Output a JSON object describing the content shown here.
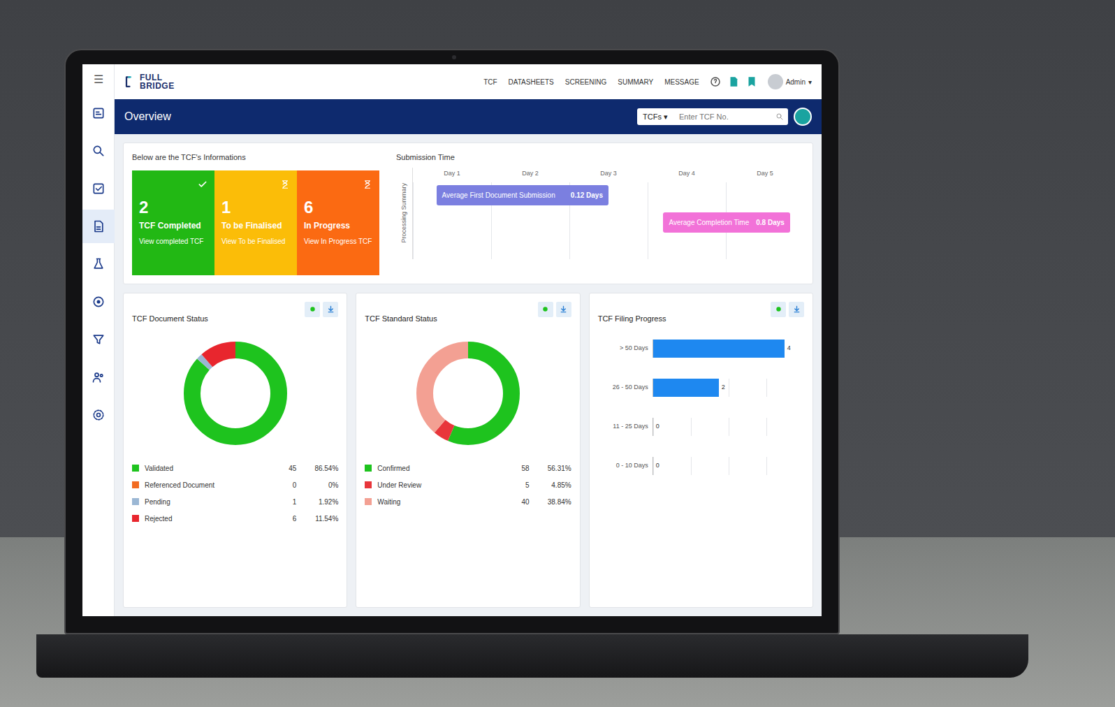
{
  "app": {
    "logo": [
      "FULL",
      "BRIDGE"
    ],
    "menu_icon": "☰"
  },
  "nav": [
    "TCF",
    "DATASHEETS",
    "SCREENING",
    "SUMMARY",
    "MESSAGE"
  ],
  "user": {
    "name": "Admin",
    "caret": "▾"
  },
  "sidebar": {
    "items": [
      {
        "selected": false
      },
      {
        "selected": false
      },
      {
        "selected": false
      },
      {
        "selected": true
      },
      {
        "selected": false
      },
      {
        "selected": false
      },
      {
        "selected": false
      },
      {
        "selected": false
      },
      {
        "selected": false
      }
    ]
  },
  "search": {
    "scope": "TCFs ▾",
    "placeholder": "Enter TCF No."
  },
  "page": {
    "title": "Overview"
  },
  "summary": {
    "caption": "Below are the TCF's Informations",
    "tiles": [
      {
        "count": "2",
        "label": "TCF Completed",
        "link": "View completed TCF",
        "color": "#22b814",
        "kind": "done"
      },
      {
        "count": "1",
        "label": "To be Finalised",
        "link": "View To be Finalised",
        "color": "#fbbd08",
        "kind": "pending"
      },
      {
        "count": "6",
        "label": "In Progress",
        "link": "View In Progress TCF",
        "color": "#fb6a12",
        "kind": "pending"
      }
    ]
  },
  "timeline": {
    "title": "Submission Time",
    "axis_label": "Processing Summary",
    "columns": [
      "Day 1",
      "Day 2",
      "Day 3",
      "Day 4",
      "Day 5"
    ],
    "bars": [
      {
        "label": "Average First Document Submission",
        "reading": "0.12 Days",
        "start": 0.3,
        "end": 2.5,
        "color": "#7b7fe0"
      },
      {
        "label": "Average Completion Time",
        "reading": "0.8 Days",
        "start": 3.2,
        "end": 4.8,
        "color": "#f272d8"
      }
    ]
  },
  "donuts": [
    {
      "title": "TCF Document Status",
      "values": [
        45,
        0,
        1,
        6
      ],
      "legend": [
        {
          "label": "Validated",
          "count": "45",
          "percent": "86.54%",
          "color": "#1ec31e"
        },
        {
          "label": "Referenced Document",
          "count": "0",
          "percent": "0%",
          "color": "#f26b21"
        },
        {
          "label": "Pending",
          "count": "1",
          "percent": "1.92%",
          "color": "#9bb7d4"
        },
        {
          "label": "Rejected",
          "count": "6",
          "percent": "11.54%",
          "color": "#e8262e"
        }
      ]
    },
    {
      "title": "TCF Standard Status",
      "values": [
        58,
        5,
        40
      ],
      "legend": [
        {
          "label": "Confirmed",
          "count": "58",
          "percent": "56.31%",
          "color": "#1ec31e"
        },
        {
          "label": "Under Review",
          "count": "5",
          "percent": "4.85%",
          "color": "#e8363b"
        },
        {
          "label": "Waiting",
          "count": "40",
          "percent": "38.84%",
          "color": "#f3a093"
        }
      ]
    }
  ],
  "filing": {
    "title": "TCF Filing Progress",
    "values": [
      4,
      2,
      0,
      0
    ],
    "rows": [
      {
        "label": "> 50 Days",
        "value": "4"
      },
      {
        "label": "26 - 50 Days",
        "value": "2"
      },
      {
        "label": "11 - 25 Days",
        "value": "0"
      },
      {
        "label": "0 - 10 Days",
        "value": "0"
      }
    ]
  }
}
